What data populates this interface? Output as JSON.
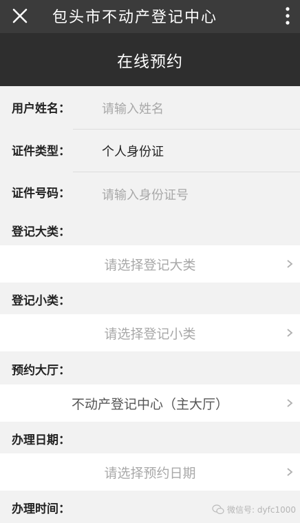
{
  "topbar": {
    "title": "包头市不动产登记中心"
  },
  "header": {
    "title": "在线预约"
  },
  "form": {
    "name": {
      "label": "用户姓名：",
      "placeholder": "请输入姓名"
    },
    "id_type": {
      "label": "证件类型：",
      "value": "个人身份证"
    },
    "id_number": {
      "label": "证件号码：",
      "placeholder": "请输入身份证号"
    },
    "category": {
      "label": "登记大类：",
      "placeholder": "请选择登记大类"
    },
    "subcategory": {
      "label": "登记小类：",
      "placeholder": "请选择登记小类"
    },
    "hall": {
      "label": "预约大厅：",
      "value": "不动产登记中心（主大厅）"
    },
    "date": {
      "label": "办理日期：",
      "placeholder": "请选择预约日期"
    },
    "time": {
      "label": "办理时间："
    }
  },
  "watermark": {
    "text": "微信号: dyfc1000"
  },
  "colors": {
    "topbar": "#3b3b3b",
    "header": "#2e2e2e",
    "background": "#f2f2f2",
    "placeholder": "#a8a8a8"
  },
  "icons": {
    "close": "close-icon",
    "more": "more-vertical-icon",
    "chevron": "chevron-right-icon",
    "watermark": "wechat-icon"
  }
}
